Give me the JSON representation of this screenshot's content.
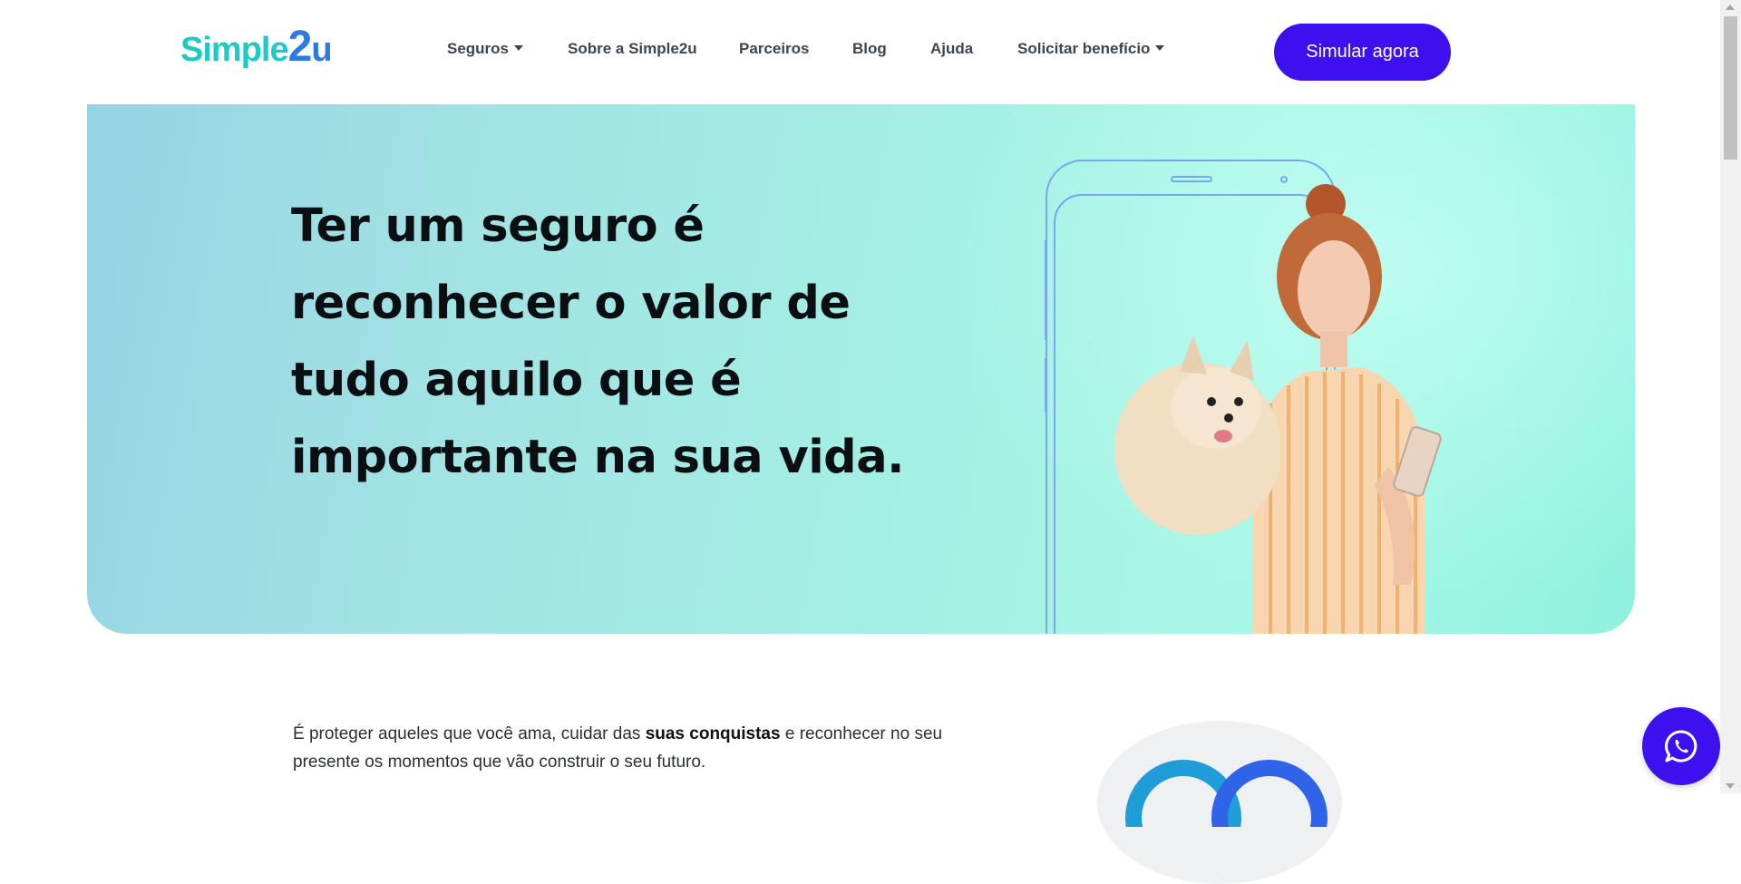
{
  "header": {
    "logo": {
      "part1": "Simple",
      "part2": "2",
      "part3": "u"
    },
    "nav": [
      {
        "label": "Seguros",
        "has_dropdown": true
      },
      {
        "label": "Sobre a Simple2u",
        "has_dropdown": false
      },
      {
        "label": "Parceiros",
        "has_dropdown": false
      },
      {
        "label": "Blog",
        "has_dropdown": false
      },
      {
        "label": "Ajuda",
        "has_dropdown": false
      },
      {
        "label": "Solicitar benefício",
        "has_dropdown": true
      }
    ],
    "cta_label": "Simular agora"
  },
  "hero": {
    "headline": "Ter um seguro é reconhecer o valor de tudo aquilo que é importante na sua vida."
  },
  "intro": {
    "part1": "É proteger aqueles que você ama, cuidar das ",
    "bold": "suas conquistas",
    "part2": " e reconhecer no seu presente os momentos que vão construir o seu futuro."
  },
  "colors": {
    "brand_primary": "#3c10ef",
    "logo_teal": "#1fc9c4",
    "logo_blue": "#2b7be0",
    "hero_start": "#97d3e4",
    "hero_end": "#8ff2dd"
  },
  "icons": {
    "dropdown": "caret-down-icon",
    "whatsapp": "whatsapp-icon"
  }
}
